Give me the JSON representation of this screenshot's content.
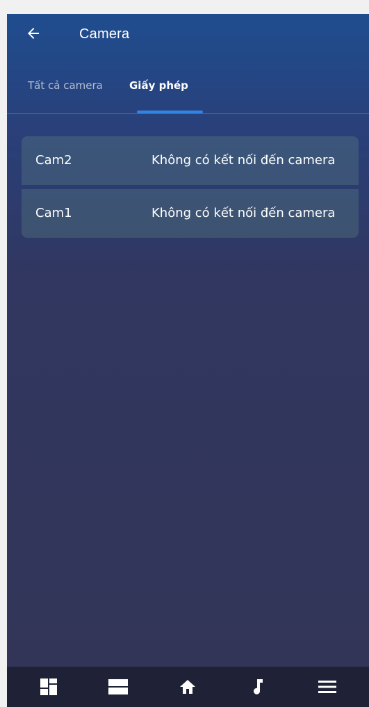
{
  "header": {
    "title": "Camera"
  },
  "tabs": [
    {
      "label": "Tất cả camera",
      "active": false
    },
    {
      "label": "Giấy phép",
      "active": true
    }
  ],
  "cameras": [
    {
      "name": "Cam2",
      "status": "Không có kết nối đến camera"
    },
    {
      "name": "Cam1",
      "status": "Không có kết nối đến camera"
    }
  ],
  "colors": {
    "tab_indicator": "#2f84e6",
    "bottom_bar": "#1f2236"
  },
  "bottom_nav": [
    {
      "icon": "dashboard-icon"
    },
    {
      "icon": "view-stream-icon"
    },
    {
      "icon": "home-icon"
    },
    {
      "icon": "music-note-icon"
    },
    {
      "icon": "menu-icon"
    }
  ]
}
